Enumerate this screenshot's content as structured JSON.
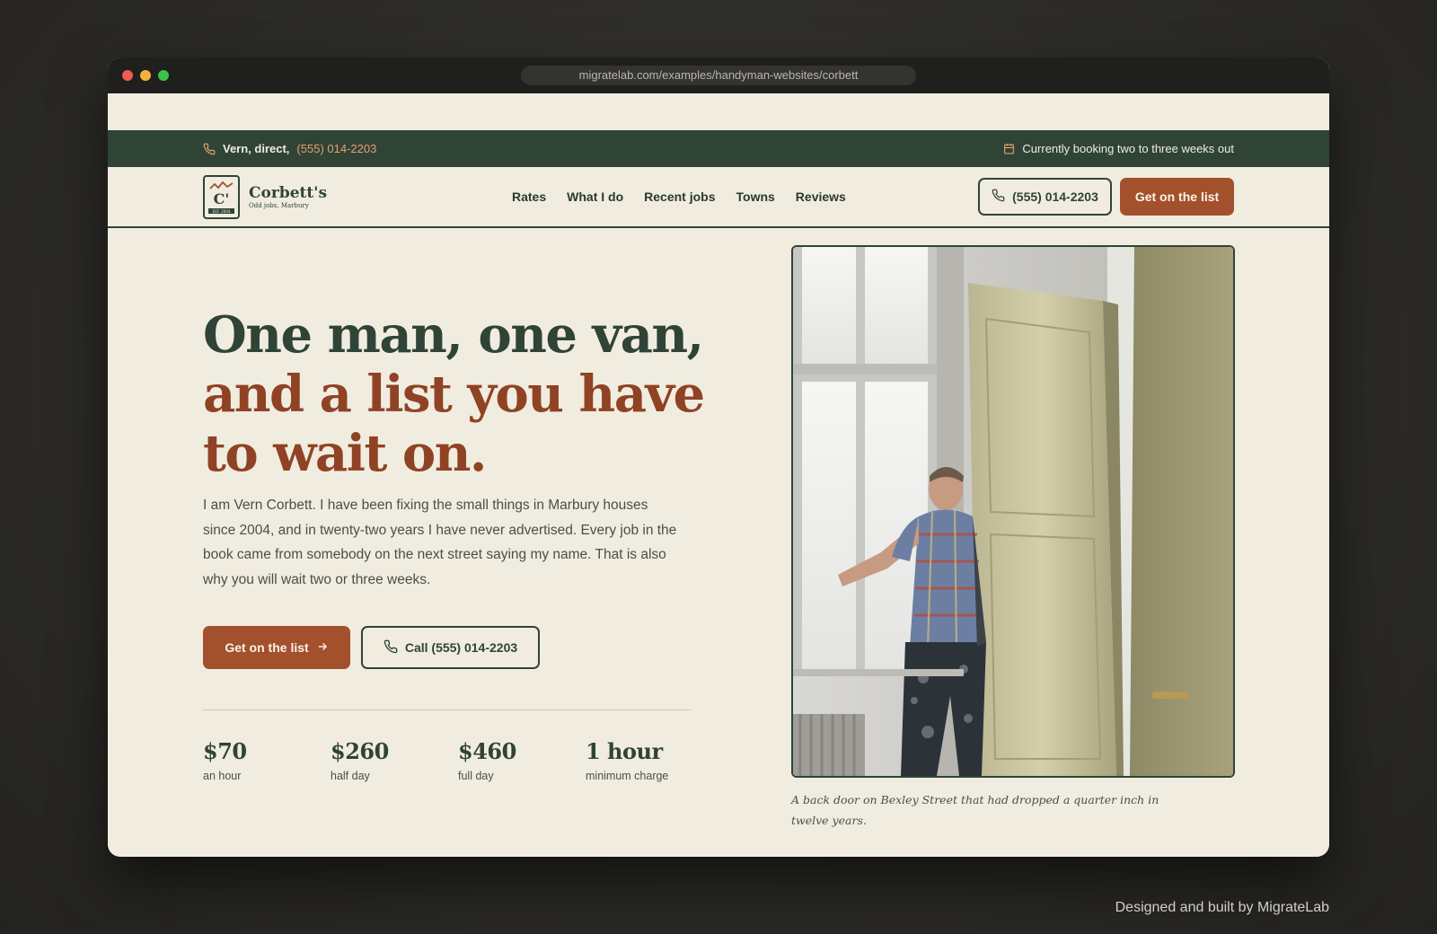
{
  "browser": {
    "url": "migratelab.com/examples/handyman-websites/corbett"
  },
  "topbar": {
    "contact_prefix": "Vern, direct,",
    "phone": "(555) 014-2203",
    "booking_status": "Currently booking two to three weeks out",
    "icons": [
      "phone-icon",
      "calendar-icon"
    ]
  },
  "nav": {
    "brand_name": "Corbett's",
    "brand_tagline": "Odd jobs, Marbury",
    "logo_letter": "C'",
    "logo_est": "EST. 2004",
    "links": [
      {
        "label": "Rates"
      },
      {
        "label": "What I do"
      },
      {
        "label": "Recent jobs"
      },
      {
        "label": "Towns"
      },
      {
        "label": "Reviews"
      }
    ],
    "phone_button": "(555) 014-2203",
    "cta_button": "Get on the list"
  },
  "hero": {
    "headline_line1": "One man, one van,",
    "headline_line2": "and a list you have to wait on.",
    "intro": "I am Vern Corbett. I have been fixing the small things in Marbury houses since 2004, and in twenty-two years I have never advertised. Every job in the book came from somebody on the next street saying my name. That is also why you will wait two or three weeks.",
    "primary_cta": "Get on the list",
    "secondary_cta": "Call (555) 014-2203",
    "stats": [
      {
        "value": "$70",
        "label": "an hour"
      },
      {
        "value": "$260",
        "label": "half day"
      },
      {
        "value": "$460",
        "label": "full day"
      },
      {
        "value": "1 hour",
        "label": "minimum charge"
      }
    ],
    "photo_caption": "A back door on Bexley Street that had dropped a quarter inch in twelve years."
  },
  "footer_credit": "Designed and built by MigrateLab",
  "colors": {
    "forest": "#2f4437",
    "rust": "#a3512c",
    "cream": "#f1ece0"
  }
}
